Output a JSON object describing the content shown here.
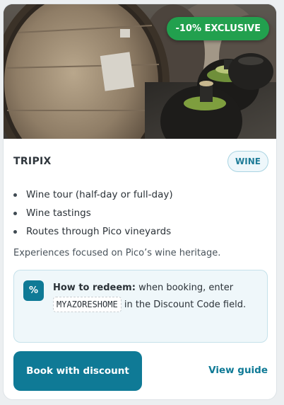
{
  "card": {
    "badge": "-10% EXCLUSIVE",
    "title": "TRIPIX",
    "tag": "WINE",
    "bullets": [
      "Wine tour (half-day or full-day)",
      "Wine tastings",
      "Routes through Pico vineyards"
    ],
    "description": "Experiences focused on Pico’s wine heritage.",
    "redeem": {
      "icon": "%",
      "label": "How to redeem:",
      "text_before": "when booking, enter",
      "code": "MYAZORESHOME",
      "text_after": "in the Discount Code field."
    },
    "primary_button": "Book with discount",
    "secondary_link": "View guide"
  },
  "colors": {
    "accent": "#0f7a96",
    "badge": "#22a04e",
    "tag_text": "#1f7c98"
  }
}
